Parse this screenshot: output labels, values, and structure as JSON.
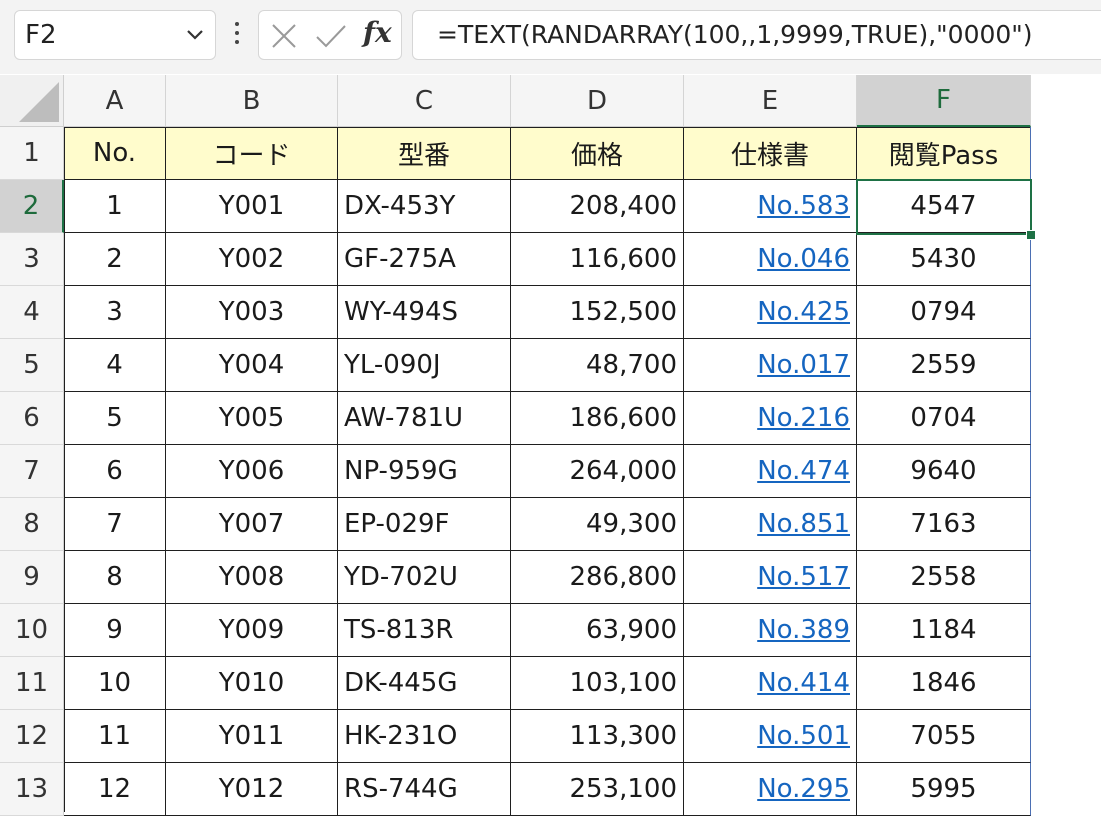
{
  "name_box": {
    "value": "F2"
  },
  "formula_bar": {
    "formula": "=TEXT(RANDARRAY(100,,1,9999,TRUE),\"0000\")",
    "fx_label": "fx"
  },
  "icons": {
    "name_box_dropdown": "chevron-down-icon",
    "more": "kebab-icon",
    "cancel": "close-icon",
    "enter": "check-icon",
    "select_all": "select-all-triangle-icon"
  },
  "columns": [
    "A",
    "B",
    "C",
    "D",
    "E",
    "F"
  ],
  "active_cell": "F2",
  "headers": [
    "No.",
    "コード",
    "型番",
    "価格",
    "仕様書",
    "閲覧Pass"
  ],
  "rows": [
    {
      "row": "2",
      "no": "1",
      "code": "Y001",
      "model": "DX-453Y",
      "price": "208,400",
      "spec": "No.583",
      "pass": "4547"
    },
    {
      "row": "3",
      "no": "2",
      "code": "Y002",
      "model": "GF-275A",
      "price": "116,600",
      "spec": "No.046",
      "pass": "5430"
    },
    {
      "row": "4",
      "no": "3",
      "code": "Y003",
      "model": "WY-494S",
      "price": "152,500",
      "spec": "No.425",
      "pass": "0794"
    },
    {
      "row": "5",
      "no": "4",
      "code": "Y004",
      "model": "YL-090J",
      "price": "48,700",
      "spec": "No.017",
      "pass": "2559"
    },
    {
      "row": "6",
      "no": "5",
      "code": "Y005",
      "model": "AW-781U",
      "price": "186,600",
      "spec": "No.216",
      "pass": "0704"
    },
    {
      "row": "7",
      "no": "6",
      "code": "Y006",
      "model": "NP-959G",
      "price": "264,000",
      "spec": "No.474",
      "pass": "9640"
    },
    {
      "row": "8",
      "no": "7",
      "code": "Y007",
      "model": "EP-029F",
      "price": "49,300",
      "spec": "No.851",
      "pass": "7163"
    },
    {
      "row": "9",
      "no": "8",
      "code": "Y008",
      "model": "YD-702U",
      "price": "286,800",
      "spec": "No.517",
      "pass": "2558"
    },
    {
      "row": "10",
      "no": "9",
      "code": "Y009",
      "model": "TS-813R",
      "price": "63,900",
      "spec": "No.389",
      "pass": "1184"
    },
    {
      "row": "11",
      "no": "10",
      "code": "Y010",
      "model": "DK-445G",
      "price": "103,100",
      "spec": "No.414",
      "pass": "1846"
    },
    {
      "row": "12",
      "no": "11",
      "code": "Y011",
      "model": "HK-231O",
      "price": "113,300",
      "spec": "No.501",
      "pass": "7055"
    },
    {
      "row": "13",
      "no": "12",
      "code": "Y012",
      "model": "RS-744G",
      "price": "253,100",
      "spec": "No.295",
      "pass": "5995"
    }
  ],
  "colors": {
    "header_fill": "#fffccc",
    "hyperlink": "#1565c0",
    "selection": "#1e7145"
  }
}
